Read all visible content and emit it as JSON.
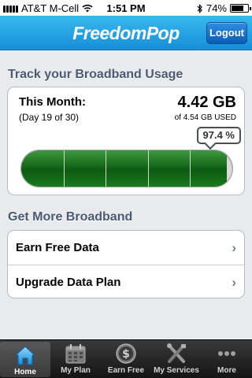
{
  "status_bar": {
    "carrier": "AT&T M-Cell",
    "time": "1:51 PM",
    "battery": "74%",
    "battery_level": 0.74,
    "icons": [
      "signal-icon",
      "wifi-icon",
      "bluetooth-icon",
      "battery-icon"
    ]
  },
  "header": {
    "title": "FreedomPop",
    "logout_label": "Logout"
  },
  "usage": {
    "section_title": "Track your Broadband Usage",
    "month_label": "This Month:",
    "day_label": "(Day 19 of 30)",
    "used_total": "4.42 GB",
    "used_of": "of 4.54 GB USED",
    "percent_label": "97.4 %",
    "percent_value": 97.4,
    "meter_segments": 5
  },
  "more_broadband": {
    "section_title": "Get More Broadband",
    "items": [
      {
        "label": "Earn Free Data"
      },
      {
        "label": "Upgrade Data Plan"
      }
    ]
  },
  "tabbar": {
    "active": "Home",
    "tabs": [
      {
        "label": "Home",
        "icon": "home-icon"
      },
      {
        "label": "My Plan",
        "icon": "calendar-icon"
      },
      {
        "label": "Earn Free",
        "icon": "dollar-icon"
      },
      {
        "label": "My Services",
        "icon": "tools-icon"
      },
      {
        "label": "More",
        "icon": "more-icon"
      }
    ]
  },
  "colors": {
    "header": "#1f9fe3",
    "meter_fill": "#16661a",
    "section_title": "#4a5a73"
  }
}
